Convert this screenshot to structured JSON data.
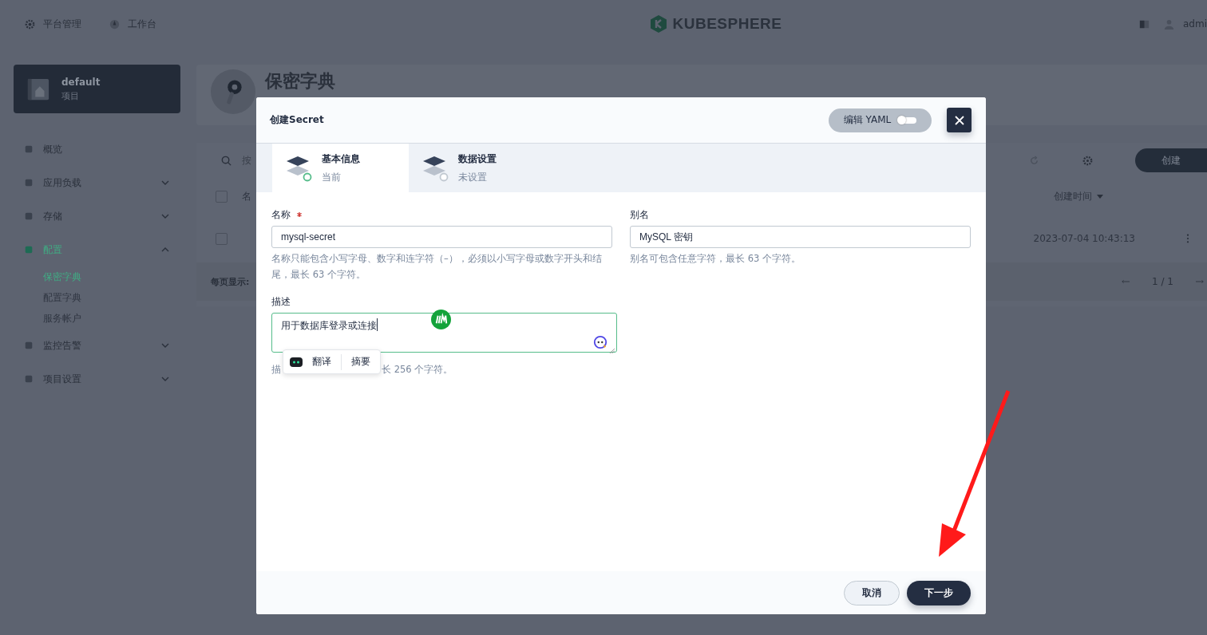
{
  "topbar": {
    "nav": [
      {
        "label": "平台管理",
        "kind": "gear"
      },
      {
        "label": "工作台",
        "kind": "compass"
      }
    ],
    "logo": "KUBESPHERE",
    "user": "admi"
  },
  "project": {
    "name": "default",
    "type": "项目"
  },
  "sidebar": {
    "items": [
      {
        "label": "概览",
        "kind": "link",
        "selected": false
      },
      {
        "label": "应用负载",
        "kind": "group",
        "expanded": false,
        "selected": false
      },
      {
        "label": "存储",
        "kind": "group",
        "expanded": false,
        "selected": false
      },
      {
        "label": "配置",
        "kind": "group",
        "expanded": true,
        "selected": true,
        "children": [
          {
            "label": "保密字典",
            "selected": true
          },
          {
            "label": "配置字典",
            "selected": false
          },
          {
            "label": "服务帐户",
            "selected": false
          }
        ]
      },
      {
        "label": "监控告警",
        "kind": "group",
        "expanded": false,
        "selected": false
      },
      {
        "label": "项目设置",
        "kind": "group",
        "expanded": false,
        "selected": false
      }
    ]
  },
  "page": {
    "title": "保密字典",
    "search_placeholder": "按",
    "columns": [
      "名",
      "创建时间"
    ],
    "select_all_checked": false,
    "rows": [
      {
        "created": "2023-07-04 10:43:13",
        "checked": false
      }
    ],
    "create_button": "创建",
    "per_page_label": "每页显示:",
    "pagination": "1 / 1"
  },
  "dialog": {
    "title": "创建Secret",
    "yaml_toggle": {
      "label": "编辑 YAML",
      "on": false
    },
    "steps": [
      {
        "title": "基本信息",
        "status": "当前",
        "selected": true
      },
      {
        "title": "数据设置",
        "status": "未设置",
        "selected": false
      }
    ],
    "name": {
      "label": "名称",
      "required": true,
      "value": "mysql-secret",
      "hint": "名称只能包含小写字母、数字和连字符（–），必须以小写字母或数字开头和结尾，最长 63 个字符。"
    },
    "alias": {
      "label": "别名",
      "value": "MySQL 密钥",
      "hint": "别名可包含任意字符，最长 63 个字符。"
    },
    "description": {
      "label": "描述",
      "value": "用于数据库登录或连接",
      "hint_start": "描",
      "hint_end": "长 256 个字符。"
    },
    "popup": {
      "items": [
        "翻译",
        "摘要"
      ]
    },
    "buttons": {
      "cancel": "取消",
      "next": "下一步"
    }
  }
}
